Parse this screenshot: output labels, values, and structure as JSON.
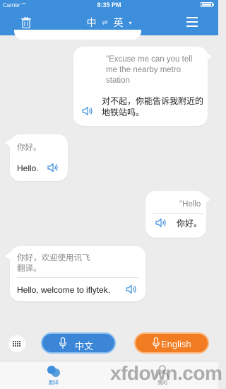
{
  "status_bar": {
    "carrier": "Carrier",
    "time": "8:35 PM"
  },
  "header": {
    "source_lang": "中",
    "swap_symbol": "⇌",
    "target_lang": "英",
    "caret": "▾"
  },
  "messages": [
    {
      "side": "right",
      "source": "\"Excuse me can you tell me the nearby metro station",
      "translation": "对不起，你能告诉我附近的地铁站吗。"
    },
    {
      "side": "left",
      "source": "你好。",
      "translation": "Hello."
    },
    {
      "side": "right",
      "source": "\"Hello",
      "translation": "你好。"
    },
    {
      "side": "left",
      "source": "你好，欢迎使用讯飞翻译。",
      "translation": "Hello, welcome to iflytek."
    }
  ],
  "input_bar": {
    "chinese_button": "中文",
    "english_button": "English"
  },
  "tab_bar": {
    "translate_label": "翻译",
    "mine_label": "我的"
  },
  "watermark": "xfdown.com",
  "colors": {
    "primary_blue": "#3d8fdc",
    "accent_orange": "#f27c21",
    "background": "#ececec"
  }
}
